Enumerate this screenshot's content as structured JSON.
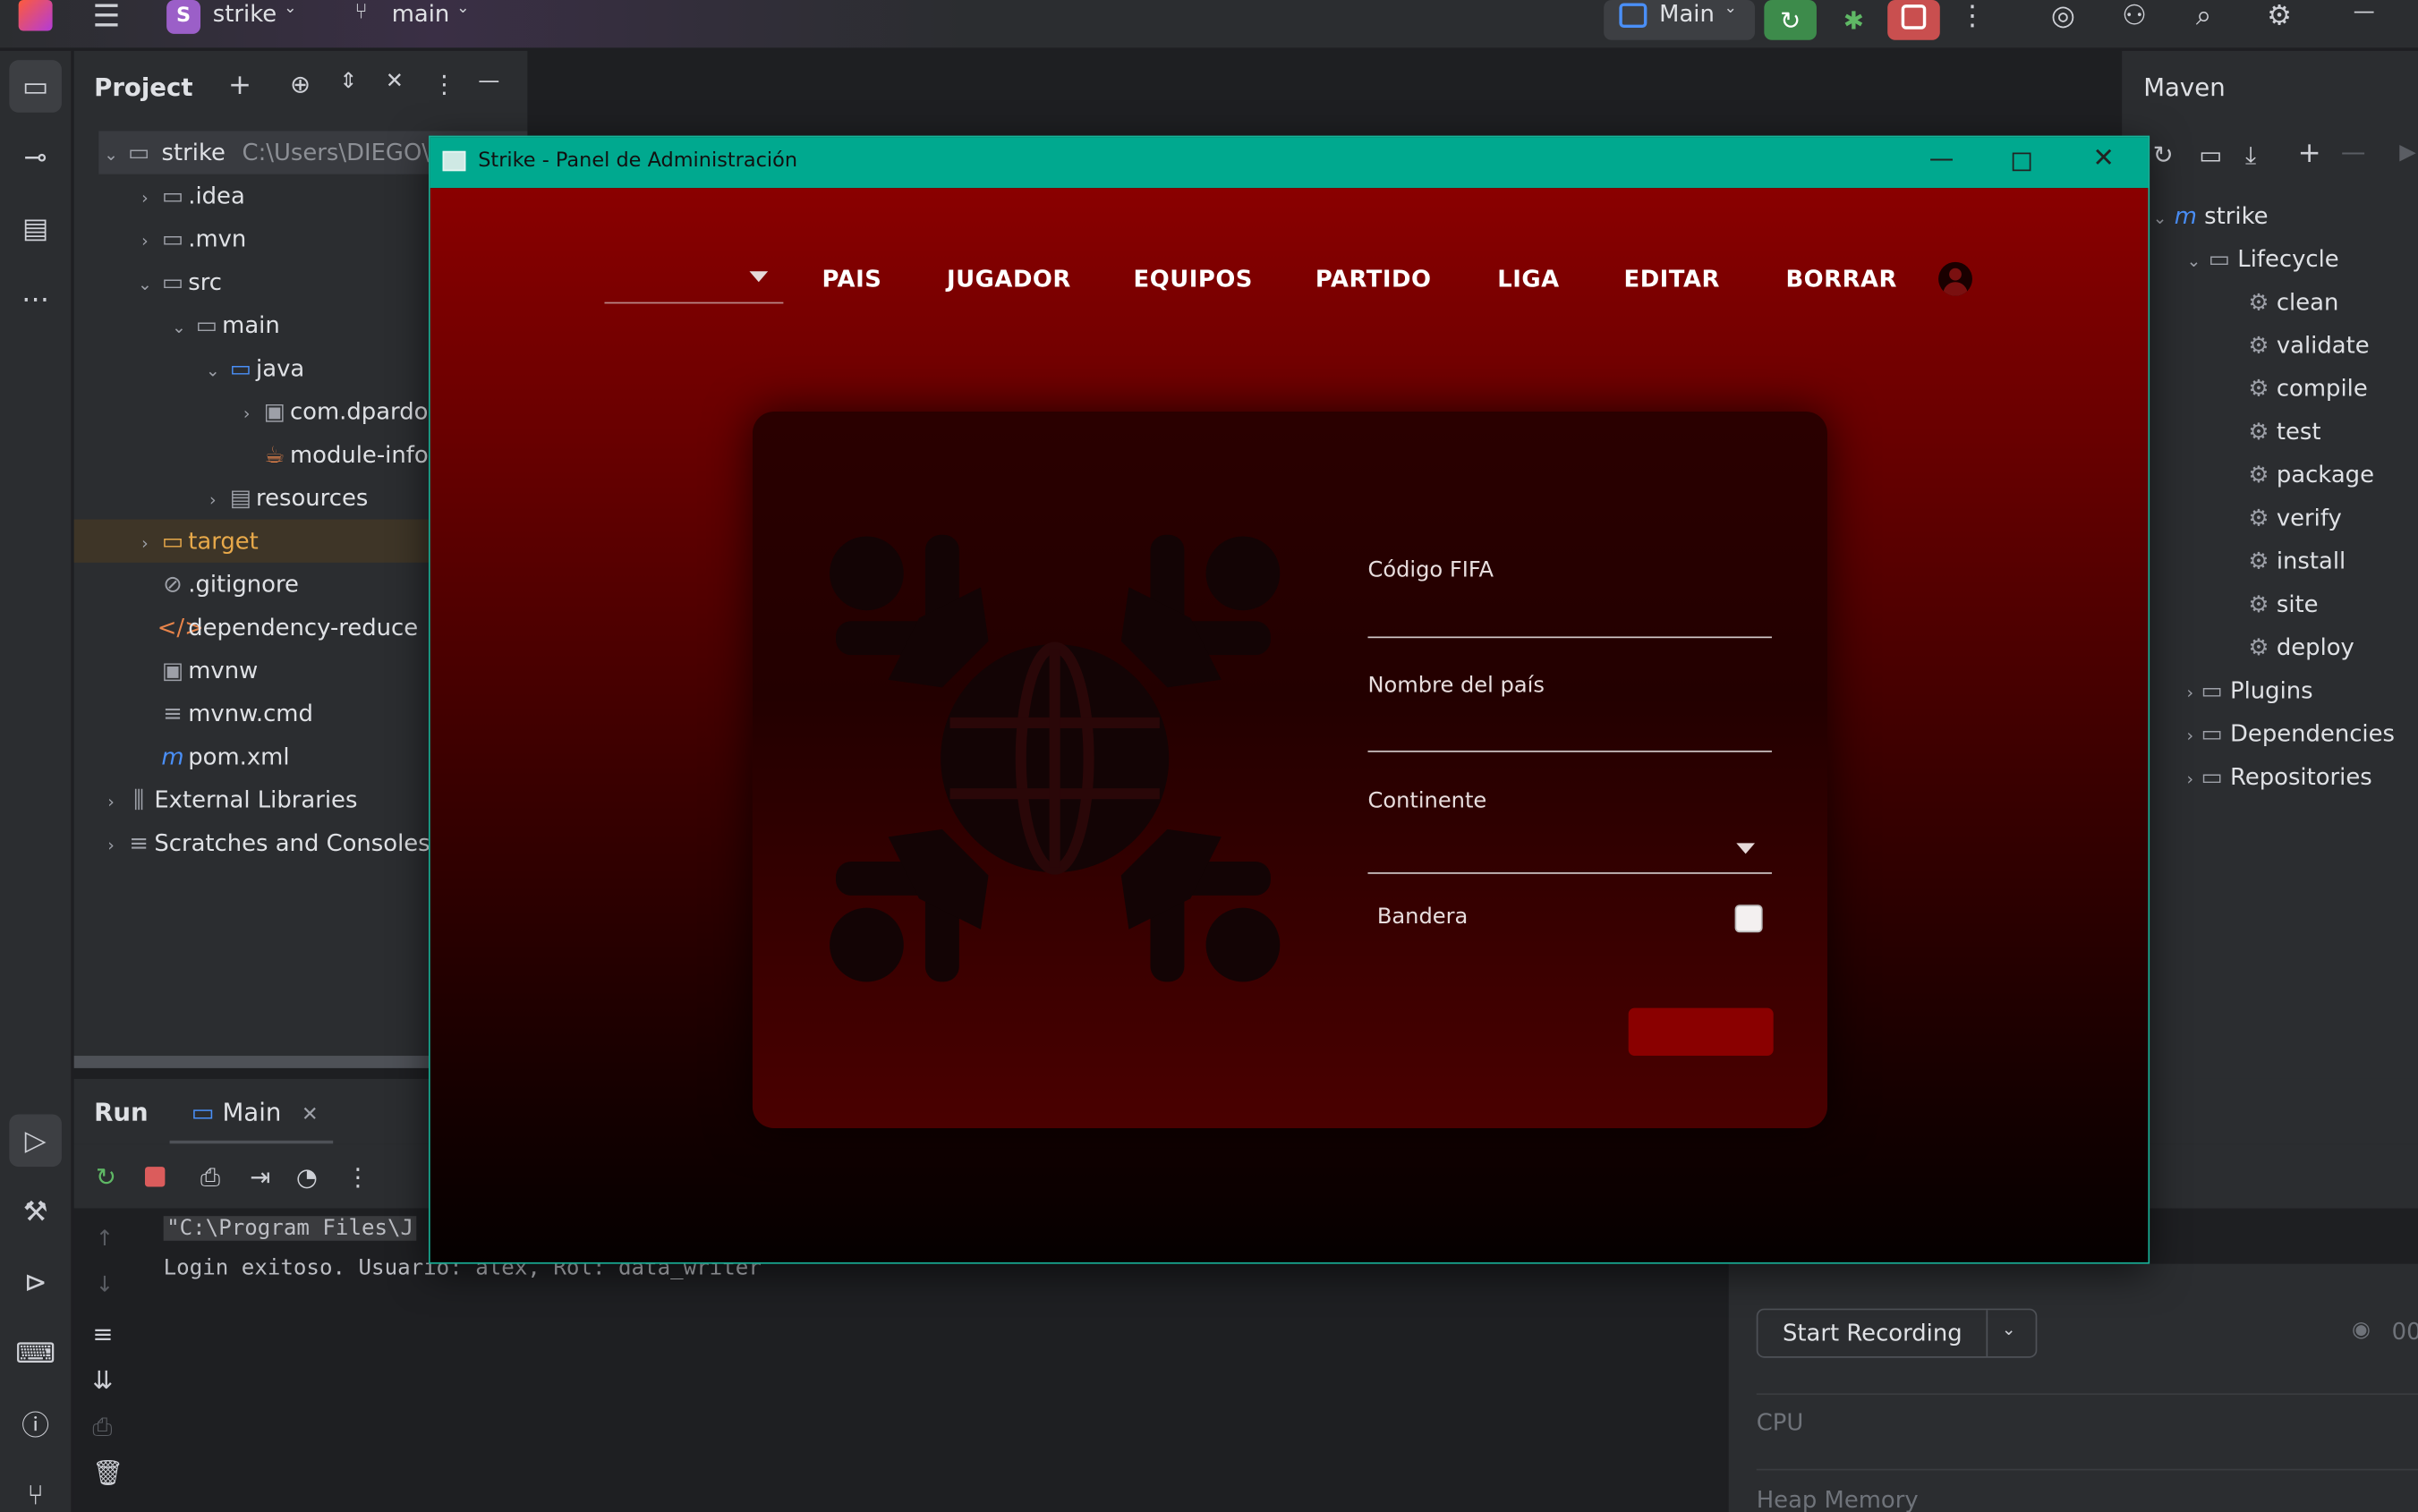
{
  "topbar": {
    "project_letter": "S",
    "project_name": "strike",
    "branch": "main",
    "run_config": "Main"
  },
  "project_panel": {
    "title": "Project",
    "items": [
      {
        "label": "strike",
        "hint": "C:\\Users\\DIEGO\\"
      },
      {
        "label": ".idea"
      },
      {
        "label": ".mvn"
      },
      {
        "label": "src"
      },
      {
        "label": "main"
      },
      {
        "label": "java"
      },
      {
        "label": "com.dpardo"
      },
      {
        "label": "module-info"
      },
      {
        "label": "resources"
      },
      {
        "label": "target"
      },
      {
        "label": ".gitignore"
      },
      {
        "label": "dependency-reduce"
      },
      {
        "label": "mvnw"
      },
      {
        "label": "mvnw.cmd"
      },
      {
        "label": "pom.xml"
      },
      {
        "label": "External Libraries"
      },
      {
        "label": "Scratches and Consoles"
      }
    ]
  },
  "maven": {
    "title": "Maven",
    "root": "strike",
    "lifecycle": "Lifecycle",
    "goals": [
      "clean",
      "validate",
      "compile",
      "test",
      "package",
      "verify",
      "install",
      "site",
      "deploy"
    ],
    "plugins": "Plugins",
    "dependencies": "Dependencies",
    "repositories": "Repositories"
  },
  "run": {
    "title": "Run",
    "tab": "Main",
    "line1": "\"C:\\Program Files\\J",
    "line2": "Login exitoso. Usuario: alex, Rol: data_writer"
  },
  "profiler": {
    "start_recording": "Start Recording",
    "timer": "00",
    "cpu": "CPU",
    "heap": "Heap Memory"
  },
  "app": {
    "window_title": "Strike - Panel de Administración",
    "nav": [
      "PAIS",
      "JUGADOR",
      "EQUIPOS",
      "PARTIDO",
      "LIGA",
      "EDITAR",
      "BORRAR"
    ],
    "form": {
      "codigo_label": "Código FIFA",
      "nombre_label": "Nombre del país",
      "continente_label": "Continente",
      "bandera_label": "Bandera"
    },
    "colors": {
      "accent": "#8a0000",
      "title_bar": "#00a98f"
    }
  }
}
